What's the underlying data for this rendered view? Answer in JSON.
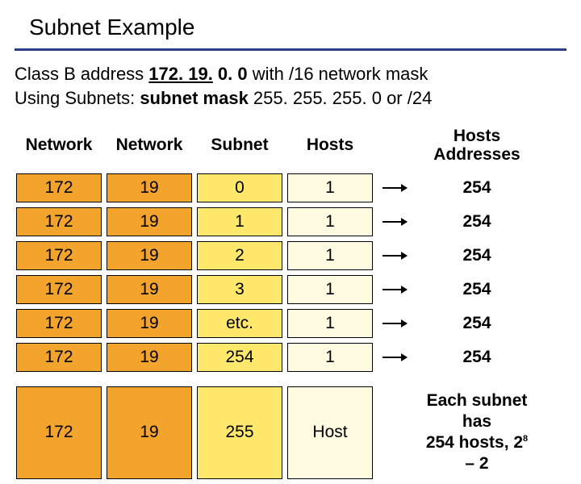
{
  "title": "Subnet Example",
  "desc": {
    "line1_pre": "Class B address ",
    "line1_u": "172. 19.",
    "line1_mid": " 0. 0",
    "line1_post": " with /16 network mask",
    "line2_pre": "Using Subnets: ",
    "line2_bold": "subnet mask",
    "line2_post": " 255. 255. 255. 0 or /24"
  },
  "headers": {
    "c0": "Network",
    "c1": "Network",
    "c2": "Subnet",
    "c3": "Hosts",
    "c4a": "Hosts",
    "c4b": "Addresses"
  },
  "rows": [
    {
      "n1": "172",
      "n2": "19",
      "sub": "0",
      "h": "1",
      "addr": "254",
      "arrow": true
    },
    {
      "n1": "172",
      "n2": "19",
      "sub": "1",
      "h": "1",
      "addr": "254",
      "arrow": true
    },
    {
      "n1": "172",
      "n2": "19",
      "sub": "2",
      "h": "1",
      "addr": "254",
      "arrow": true
    },
    {
      "n1": "172",
      "n2": "19",
      "sub": "3",
      "h": "1",
      "addr": "254",
      "arrow": true
    },
    {
      "n1": "172",
      "n2": "19",
      "sub": "etc.",
      "h": "1",
      "addr": "254",
      "arrow": true
    },
    {
      "n1": "172",
      "n2": "19",
      "sub": "254",
      "h": "1",
      "addr": "254",
      "arrow": true
    }
  ],
  "lastRow": {
    "n1": "172",
    "n2": "19",
    "sub": "255",
    "h": "Host"
  },
  "note": {
    "l1": "Each subnet has",
    "l2a": "254 hosts, 2",
    "l2sup": "8",
    "l2b": " – 2"
  },
  "colors": {
    "net": "#f2a42c",
    "sub": "#ffe86b",
    "host": "#fffbe0",
    "rule": "#2a3e8a"
  }
}
